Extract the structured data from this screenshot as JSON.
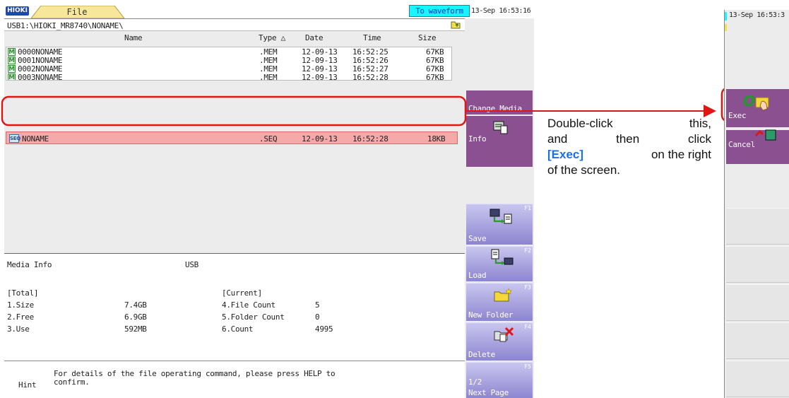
{
  "app": {
    "logo": "HIOKI",
    "file_tab": "File",
    "to_waveform": "To waveform",
    "datetime": "13-Sep 16:53:16"
  },
  "path": "USB1:\\HIOKI_MR8740\\NONAME\\",
  "columns": {
    "name": "Name",
    "type": "Type △",
    "date": "Date",
    "time": "Time",
    "size": "Size"
  },
  "files": [
    {
      "icon": "M",
      "name": "0000NONAME",
      "type": ".MEM",
      "date": "12-09-13",
      "time": "16:52:25",
      "size": "67KB"
    },
    {
      "icon": "M",
      "name": "0001NONAME",
      "type": ".MEM",
      "date": "12-09-13",
      "time": "16:52:26",
      "size": "67KB"
    },
    {
      "icon": "M",
      "name": "0002NONAME",
      "type": ".MEM",
      "date": "12-09-13",
      "time": "16:52:27",
      "size": "67KB"
    },
    {
      "icon": "M",
      "name": "0003NONAME",
      "type": ".MEM",
      "date": "12-09-13",
      "time": "16:52:28",
      "size": "67KB"
    }
  ],
  "selected_file": {
    "icon": "SEQ",
    "name": "NONAME",
    "type": ".SEQ",
    "date": "12-09-13",
    "time": "16:52:28",
    "size": "18KB"
  },
  "media": {
    "title": "Media Info",
    "device": "USB",
    "total_label": "[Total]",
    "current_label": "[Current]",
    "size_label": "1.Size",
    "size_value": "7.4GB",
    "free_label": "2.Free",
    "free_value": "6.9GB",
    "use_label": "3.Use",
    "use_value": "592MB",
    "file_count_label": "4.File Count",
    "file_count_value": "5",
    "folder_count_label": "5.Folder Count",
    "folder_count_value": "0",
    "count_label": "6.Count",
    "count_value": "4995"
  },
  "hint": {
    "label": "Hint",
    "text_line1": "For details of the file operating command, please press HELP to",
    "text_line2": "confirm."
  },
  "side": {
    "change_media": "Change Media",
    "info": "Info",
    "save": "Save",
    "save_fn": "F1",
    "load": "Load",
    "load_fn": "F2",
    "new_folder": "New Folder",
    "new_folder_fn": "F3",
    "delete": "Delete",
    "delete_fn": "F4",
    "next_page_num": "1/2",
    "next_page": "Next Page",
    "next_page_fn": "F5"
  },
  "callout": {
    "w1": "Double-click",
    "w2": "this,",
    "w3": "and",
    "w4": "then",
    "w5": "click",
    "w6": "[Exec]",
    "w7": "on the right",
    "w8": "of the screen."
  },
  "right_panel": {
    "datetime": "13-Sep 16:53:3",
    "exec": "Exec",
    "cancel": "Cancel"
  },
  "colors": {
    "to_waveform_bg": "#18f5ff",
    "selection_bg": "#f5a9a9",
    "highlight_red": "#e01515",
    "button_purple": "#8a5090",
    "exec_text": "#1a6ee8"
  }
}
